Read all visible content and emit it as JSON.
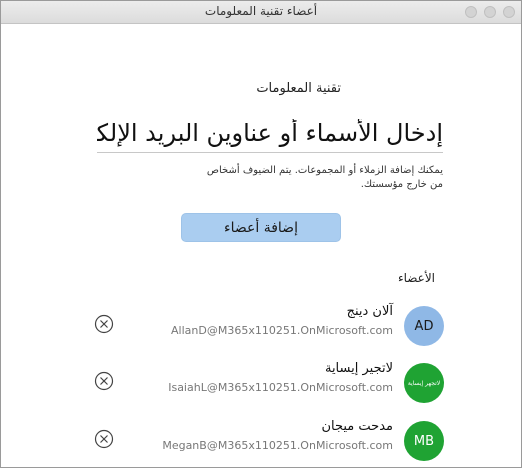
{
  "window": {
    "title": "أعضاء تقنية المعلومات"
  },
  "header": {
    "heading": "تقنية المعلومات"
  },
  "add_members": {
    "input_placeholder": "إدخال الأسماء أو عناوين البريد الإلكتروني",
    "hint_line1": "يمكنك إضافة الزملاء أو المجموعات. يتم الضيوف أشخاص",
    "hint_line2": "من خارج مؤسستك.",
    "button_label": "إضافة أعضاء"
  },
  "members_section": {
    "label": "الأعضاء",
    "members": [
      {
        "name": "آلان دينج",
        "email": "AllanD@M365x110251.OnMicrosoft.com",
        "avatar_text": "AD",
        "avatar_color": "#8fb8e6"
      },
      {
        "name": "لاتجير إيساية",
        "email": "IsaiahL@M365x110251.OnMicrosoft.com",
        "avatar_text": "لاتجهر إيساية",
        "avatar_color": "#1fa333"
      },
      {
        "name": "مدحت ميجان",
        "email": "MeganB@M365x110251.OnMicrosoft.com",
        "avatar_text": "MB",
        "avatar_color": "#1fa333"
      }
    ]
  },
  "icons": {
    "remove": "close-circle-icon"
  }
}
